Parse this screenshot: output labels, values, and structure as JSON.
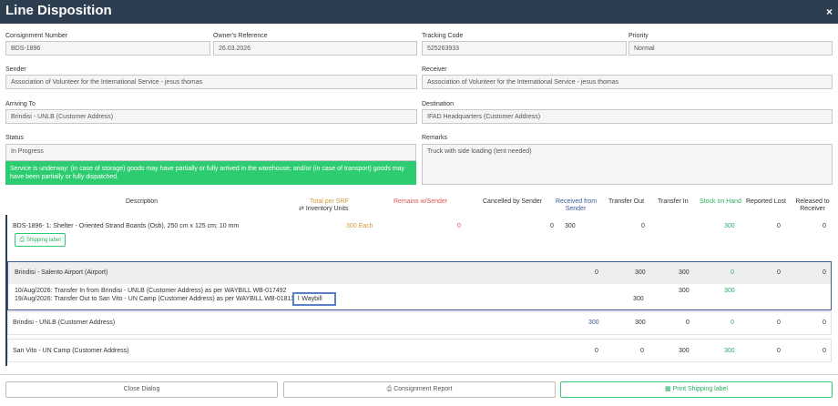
{
  "dialog": {
    "title": "Line Disposition",
    "close": "×"
  },
  "fields": {
    "consignment_number": {
      "label": "Consignment Number",
      "value": "BDS-1896"
    },
    "owners_reference": {
      "label": "Owner's Reference",
      "value": "26.03.2026"
    },
    "tracking_code": {
      "label": "Tracking Code",
      "value": "525263933"
    },
    "priority": {
      "label": "Priority",
      "value": "Normal"
    },
    "sender": {
      "label": "Sender",
      "value": "Association of Volunteer for the International Service - jesus thomas"
    },
    "receiver": {
      "label": "Receiver",
      "value": "Association of Volunteer for the International Service - jesus thomas"
    },
    "arriving_to": {
      "label": "Arriving To",
      "value": "Brindisi - UNLB (Customer Address)"
    },
    "destination": {
      "label": "Destination",
      "value": "IFAD Headquarters (Customer Address)"
    },
    "status": {
      "label": "Status",
      "value": "In Progress",
      "alert": "Service is underway: (in case of storage) goods may have partially or fully arrived in the warehouse; and/or (in case of transport) goods may have been partially or fully dispatched."
    },
    "remarks": {
      "label": "Remarks",
      "value": "Truck with side loading (tent needed)"
    }
  },
  "table": {
    "headers": {
      "description": "Description",
      "total_per_srf": "Total per SRF",
      "inventory_units": "Inventory Units",
      "remains_w_sender": "Remains w/Sender",
      "cancelled_by_sender": "Cancelled by Sender",
      "received_from_sender_1": "Received from",
      "received_from_sender_2": "Sender",
      "transfer_out": "Transfer Out",
      "transfer_in": "Transfer In",
      "stock_on_hand": "Stock on Hand",
      "reported_lost": "Reported Lost",
      "released_to_receiver_1": "Released to",
      "released_to_receiver_2": "Receiver"
    },
    "item": {
      "description": "BDS-1896- 1: Shelter - Oriented Strand Boards (Osb), 250 cm x 125 cm; 10 mm",
      "shipping_label": "Shipping label",
      "total": "300 Each",
      "remains": "0",
      "cancelled": "0",
      "received": "300",
      "transfer_out": "0",
      "stock": "300",
      "lost": "0",
      "released": "0"
    },
    "locations": [
      {
        "name": "Brindisi - Salento Airport (Airport)",
        "received": "0",
        "transfer_out": "300",
        "transfer_in": "300",
        "stock": "0",
        "lost": "0",
        "released": "0"
      },
      {
        "name": "Brindisi - UNLB (Customer Address)",
        "received": "300",
        "transfer_out": "300",
        "transfer_in": "0",
        "stock": "0",
        "lost": "0",
        "released": "0"
      },
      {
        "name": "San Vito - UN Camp (Customer Address)",
        "received": "0",
        "transfer_out": "0",
        "transfer_in": "300",
        "stock": "300",
        "lost": "0",
        "released": "0"
      }
    ],
    "transfers": [
      {
        "text": "10/Aug/2026: Transfer In from Brindisi - UNLB (Customer Address) as per WAYBILL WB-017492",
        "transfer_in": "300",
        "stock": "300"
      },
      {
        "text": "19/Aug/2026: Transfer Out to San Vito - UN Camp (Customer Address) as per WAYBILL WB-018113",
        "transfer_out": "300"
      }
    ],
    "waybill_label": "Waybill"
  },
  "footer": {
    "close": "Close Dialog",
    "report": "Consignment Report",
    "print": "Print Shipping label"
  }
}
